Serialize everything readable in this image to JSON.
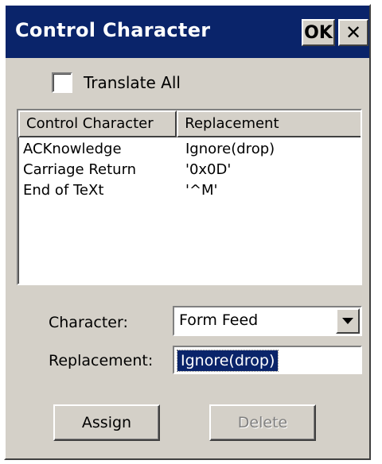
{
  "titlebar": {
    "title": "Control Character",
    "ok_label": "OK",
    "close_label": "✕"
  },
  "translate_all": {
    "label": "Translate All",
    "checked": false
  },
  "table": {
    "columns": [
      "Control Character",
      "Replacement"
    ],
    "rows": [
      [
        "ACKnowledge",
        "Ignore(drop)"
      ],
      [
        "Carriage Return",
        "'0x0D'"
      ],
      [
        "End of TeXt",
        "'^M'"
      ]
    ]
  },
  "form": {
    "character_label": "Character:",
    "character_value": "Form Feed",
    "replacement_label": "Replacement:",
    "replacement_value": "Ignore(drop)"
  },
  "buttons": {
    "assign": "Assign",
    "delete": "Delete"
  },
  "colors": {
    "titlebar": "#0a246a",
    "face": "#d4d0c8",
    "selection": "#0a246a"
  }
}
